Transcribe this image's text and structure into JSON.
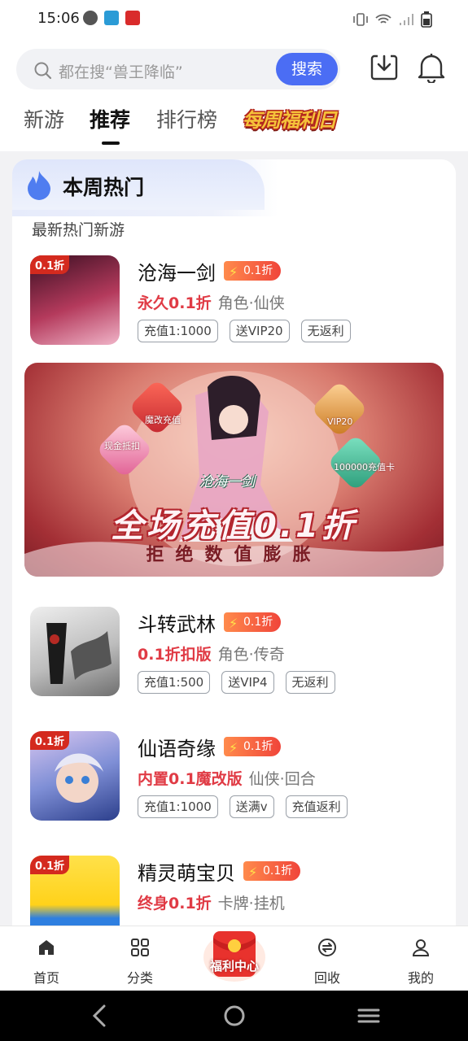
{
  "status_bar": {
    "time": "15:06"
  },
  "search": {
    "placeholder": "都在搜“兽王降临”",
    "button": "搜索"
  },
  "tabs": [
    {
      "label": "新游"
    },
    {
      "label": "推荐"
    },
    {
      "label": "排行榜"
    }
  ],
  "promo_tab": "每周福利日",
  "section": {
    "title": "本周热门",
    "subtitle": "最新热门新游"
  },
  "games": [
    {
      "title": "沧海一剑",
      "discount": "0.1折",
      "highlight": "永久0.1折",
      "genre": "角色·仙侠",
      "tags": [
        "充值1:1000",
        "送VIP20",
        "无返利"
      ],
      "thumb_badge": "0.1折",
      "thumb_color": "#6b1f3c"
    },
    {
      "title": "斗转武林",
      "discount": "0.1折",
      "highlight": "0.1折扣版",
      "genre": "角色·传奇",
      "tags": [
        "充值1:500",
        "送VIP4",
        "无返利"
      ],
      "thumb_badge": "",
      "thumb_color": "#cfcfcf"
    },
    {
      "title": "仙语奇缘",
      "discount": "0.1折",
      "highlight": "内置0.1魔改版",
      "genre": "仙侠·回合",
      "tags": [
        "充值1:1000",
        "送满v",
        "充值返利"
      ],
      "thumb_badge": "0.1折",
      "thumb_color": "#4a6fb8"
    },
    {
      "title": "精灵萌宝贝",
      "discount": "0.1折",
      "highlight": "终身0.1折",
      "genre": "卡牌·挂机",
      "tags": [],
      "thumb_badge": "0.1折",
      "thumb_color": "#2e7fe0"
    }
  ],
  "banner": {
    "game_name": "沧海一剑",
    "main_text": "全场充值0.1折",
    "sub_text": "拒绝数值膨胀",
    "icons": [
      "魔改充值",
      "现金抵扣",
      "VIP20",
      "100000充值卡"
    ]
  },
  "bottom_nav": [
    {
      "label": "首页",
      "icon": "home-icon"
    },
    {
      "label": "分类",
      "icon": "category-icon"
    },
    {
      "label": "回收",
      "icon": "recycle-icon"
    },
    {
      "label": "我的",
      "icon": "profile-icon"
    }
  ],
  "welfare_center": "福利中心",
  "colors": {
    "accent": "#4b6df4",
    "highlight": "#e03b45",
    "discount": "#f0453a"
  }
}
